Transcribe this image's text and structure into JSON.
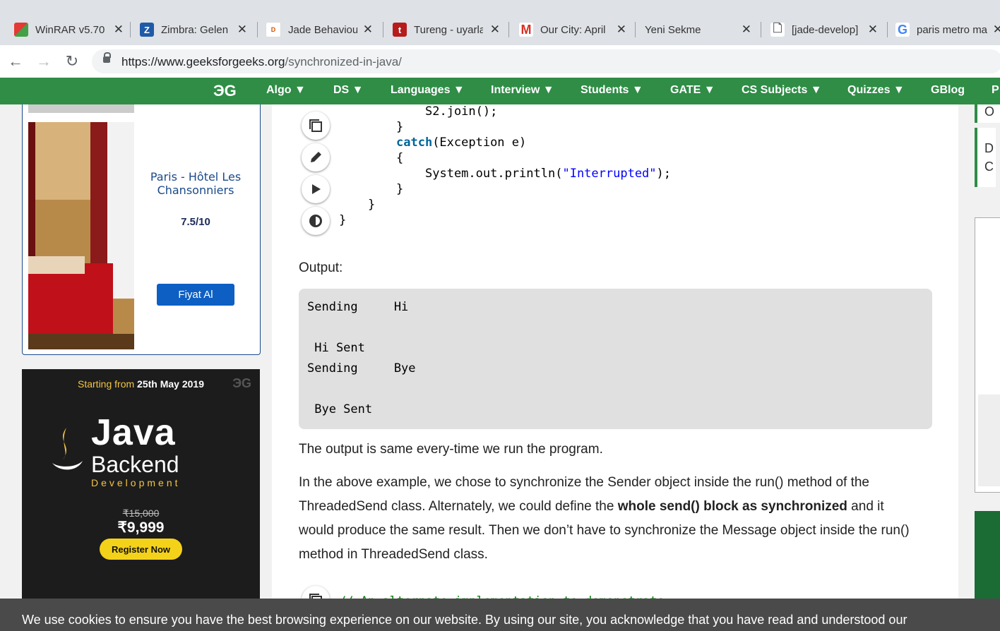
{
  "browser": {
    "tabs": [
      {
        "title": "WinRAR v5.70",
        "icon": "winrar-icon",
        "color": "#c0392b"
      },
      {
        "title": "Zimbra: Gelen",
        "icon": "zimbra-icon",
        "color": "#1f5aa8"
      },
      {
        "title": "Jade Behaviour",
        "icon": "diro-icon",
        "color": "#d35400"
      },
      {
        "title": "Tureng - uyarla",
        "icon": "tureng-icon",
        "color": "#b71c1c"
      },
      {
        "title": "Our City: April",
        "icon": "gmail-icon",
        "color": "#d93025"
      },
      {
        "title": "Yeni Sekme",
        "icon": "",
        "color": ""
      },
      {
        "title": "[jade-develop]",
        "icon": "document-icon",
        "color": "#5f6368"
      },
      {
        "title": "paris metro ma",
        "icon": "google-icon",
        "color": "#4285f4"
      }
    ],
    "url_domain": "https://www.geeksforgeeks.org",
    "url_path": "/synchronized-in-java/"
  },
  "nav": {
    "logo": "ЭG",
    "items": [
      "Algo ▼",
      "DS ▼",
      "Languages ▼",
      "Interview ▼",
      "Students ▼",
      "GATE ▼",
      "CS Subjects ▼",
      "Quizzes ▼",
      "GBlog",
      "P"
    ]
  },
  "sidebar": {
    "hotel": {
      "name": "Paris - Hôtel Les Chansonniers",
      "rating": "7.5/10",
      "button": "Fiyat Al"
    },
    "ad": {
      "starting_prefix": "Starting from ",
      "starting_date": "25th May 2019",
      "gfg": "ЭG",
      "java": "Java",
      "backend": "Backend",
      "development": "Development",
      "old_price": "₹15,000",
      "price": "₹9,999",
      "register": "Register Now"
    }
  },
  "code": {
    "lines": [
      "S2.join();",
      "}",
      "catch",
      "(Exception e)",
      "{",
      "System.out.println(",
      "\"Interrupted\"",
      ");",
      "}",
      "}",
      "}"
    ],
    "last_line": "// An alternate implementation to demonstrate"
  },
  "content": {
    "output_label": "Output:",
    "output_lines": [
      "Sending     Hi",
      "",
      " Hi Sent",
      "Sending     Bye",
      "",
      " Bye Sent"
    ],
    "para1": "The output is same every-time we run the program.",
    "para2_a": "In the above example, we chose to synchronize the Sender object inside the run() method of the ThreadedSend class. Alternately, we could define the ",
    "para2_b": "whole send() block as synchronized",
    "para2_c": " and it would produce the same result. Then we don’t have to synchronize the Message object inside the run() method in ThreadedSend class."
  },
  "rightcol": {
    "box1": "O",
    "box2": "D C"
  },
  "cookie": {
    "text": "We use cookies to ensure you have the best browsing experience on our website. By using our site, you acknowledge that you have read and understood our"
  }
}
